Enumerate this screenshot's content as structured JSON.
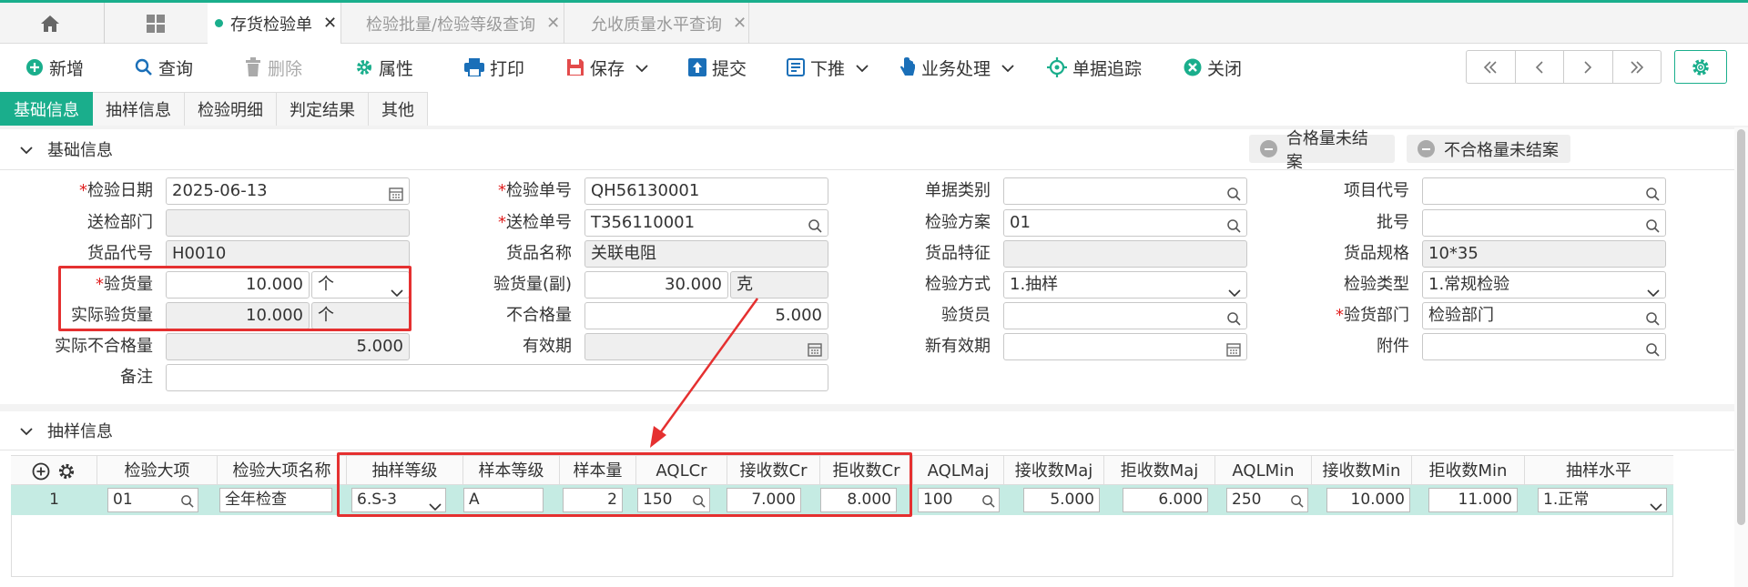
{
  "tabs": [
    {
      "label": "存货检验单",
      "active": true
    },
    {
      "label": "检验批量/检验等级查询",
      "active": false
    },
    {
      "label": "允收质量水平查询",
      "active": false
    }
  ],
  "toolbar": {
    "add": "新增",
    "query": "查询",
    "delete": "删除",
    "attributes": "属性",
    "print": "打印",
    "save": "保存",
    "submit": "提交",
    "push_down": "下推",
    "business": "业务处理",
    "trace": "单据追踪",
    "close": "关闭"
  },
  "section_tabs": [
    "基础信息",
    "抽样信息",
    "检验明细",
    "判定结果",
    "其他"
  ],
  "basic": {
    "title": "基础信息",
    "status_qualified": "合格量未结案",
    "status_unqualified": "不合格量未结案",
    "labels": {
      "inspect_date": "检验日期",
      "send_dept": "送检部门",
      "item_code": "货品代号",
      "inspect_qty": "验货量",
      "actual_inspect_qty": "实际验货量",
      "actual_unqualified": "实际不合格量",
      "remark": "备注",
      "inspect_no": "检验单号",
      "send_no": "送检单号",
      "item_name": "货品名称",
      "inspect_qty_sub": "验货量(副)",
      "unqualified_qty": "不合格量",
      "valid_period": "有效期",
      "doc_type": "单据类别",
      "inspect_plan": "检验方案",
      "item_feature": "货品特征",
      "inspect_method": "检验方式",
      "inspector": "验货员",
      "new_valid_period": "新有效期",
      "project_code": "项目代号",
      "batch_no": "批号",
      "item_spec": "货品规格",
      "inspect_type": "检验类型",
      "inspect_dept": "验货部门",
      "attachment": "附件"
    },
    "values": {
      "inspect_date": "2025-06-13",
      "item_code": "H0010",
      "inspect_qty": "10.000",
      "inspect_unit": "个",
      "actual_inspect_qty": "10.000",
      "actual_unit": "个",
      "actual_unqualified": "5.000",
      "inspect_no": "QH56130001",
      "send_no": "T356110001",
      "item_name": "关联电阻",
      "inspect_qty_sub": "30.000",
      "sub_unit": "克",
      "unqualified_qty": "5.000",
      "inspect_plan": "01",
      "inspect_method": "1.抽样",
      "item_spec": "10*35",
      "inspect_type": "1.常规检验",
      "inspect_dept": "检验部门"
    }
  },
  "sampling": {
    "title": "抽样信息",
    "headers": [
      "检验大项",
      "检验大项名称",
      "抽样等级",
      "样本等级",
      "样本量",
      "AQLCr",
      "接收数Cr",
      "拒收数Cr",
      "AQLMaj",
      "接收数Maj",
      "拒收数Maj",
      "AQLMin",
      "接收数Min",
      "拒收数Min",
      "抽样水平"
    ],
    "row": {
      "index": "1",
      "major_item": "01",
      "major_item_name": "全年检查",
      "sampling_level": "6.S-3",
      "sample_level": "A",
      "sample_size": "2",
      "aql_cr": "150",
      "accept_cr": "7.000",
      "reject_cr": "8.000",
      "aql_maj": "100",
      "accept_maj": "5.000",
      "reject_maj": "6.000",
      "aql_min": "250",
      "accept_min": "10.000",
      "reject_min": "11.000",
      "sampling_std": "1.正常"
    }
  },
  "colors": {
    "accent": "#1aae8c",
    "highlight": "#e53030",
    "row": "#c5ebe3"
  }
}
